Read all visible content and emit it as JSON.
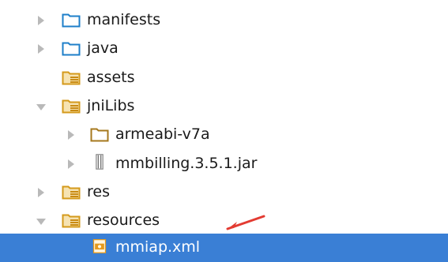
{
  "colors": {
    "selection": "#3a7fd5",
    "folder": "#1e7fc9",
    "resource_folder": "#d49a1b",
    "jar": "#8a8a8a",
    "xml": "#e59a1d",
    "callout_arrow": "#e33b32"
  },
  "tree": {
    "items": [
      {
        "label": "manifests",
        "state": "collapsed",
        "icon": "folder-icon"
      },
      {
        "label": "java",
        "state": "collapsed",
        "icon": "folder-icon"
      },
      {
        "label": "assets",
        "state": "none",
        "icon": "resource-folder-icon"
      },
      {
        "label": "jniLibs",
        "state": "expanded",
        "icon": "resource-folder-icon"
      },
      {
        "label": "armeabi-v7a",
        "state": "collapsed",
        "icon": "folder-icon"
      },
      {
        "label": "mmbilling.3.5.1.jar",
        "state": "collapsed",
        "icon": "jar-icon"
      },
      {
        "label": "res",
        "state": "collapsed",
        "icon": "resource-folder-icon"
      },
      {
        "label": "resources",
        "state": "expanded",
        "icon": "resource-folder-icon"
      },
      {
        "label": "mmiap.xml",
        "state": "selected",
        "icon": "xml-file-icon"
      }
    ]
  }
}
